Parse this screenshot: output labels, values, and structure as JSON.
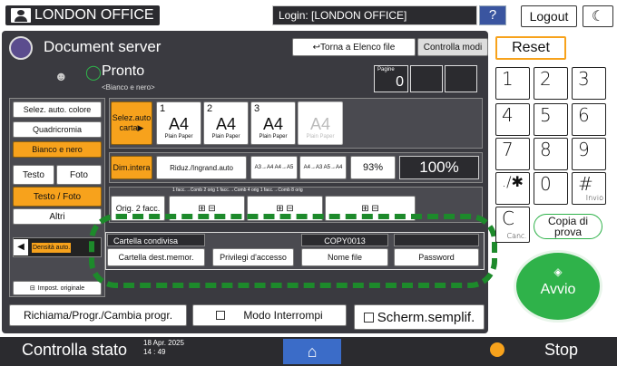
{
  "top": {
    "office": "LONDON OFFICE",
    "login": "Login: [LONDON OFFICE]",
    "help": "?",
    "logout": "Logout"
  },
  "header": {
    "title": "Document server",
    "toma": "Torna a Elenco file",
    "controlla": "Controlla modi",
    "status": "Pronto",
    "substatus": "<Bianco e nero>",
    "pagine_label": "Pagine",
    "pagine_value": "0"
  },
  "left": {
    "selez_colore": "Selez. auto. colore",
    "quadricromia": "Quadricromia",
    "bianco_nero": "Bianco e nero",
    "testo": "Testo",
    "foto": "Foto",
    "testo_foto": "Testo / Foto",
    "altri": "Altri",
    "densita": "Densità auto.",
    "impost": "Impost. originale"
  },
  "paper": {
    "selez_auto": "Selez.auto carta▶",
    "trays": [
      {
        "num": "1",
        "size": "A4",
        "type": "Plain Paper"
      },
      {
        "num": "2",
        "size": "A4",
        "type": "Plain Paper"
      },
      {
        "num": "3",
        "size": "A4",
        "type": "Plain Paper"
      },
      {
        "num": "",
        "size": "A4",
        "type": "Plain Paper"
      }
    ]
  },
  "reduce": {
    "dim_intera": "Dim.intera",
    "riduz": "Riduz./Ingrand.auto",
    "a3a4": "A3→A4 A4→A5",
    "a4a3": "A4→A3 A5→A4",
    "pct": "93%",
    "zoom": "100%"
  },
  "combine": {
    "header": "1 facc.→Comb 2 orig 1 facc.→Comb 4 orig 1 facc.→Comb 8 orig",
    "orig": "Orig. 2 facc."
  },
  "overlay": {
    "cartella_condivisa": "Cartella condivisa",
    "copy_id": "COPY0013",
    "cartella_dest": "Cartella dest.memor.",
    "privilegi": "Privilegi d'accesso",
    "nome_file": "Nome file",
    "password": "Password"
  },
  "bottom": {
    "richiama": "Richiama/Progr./Cambia progr.",
    "modo_interrompi": "Modo Interrompi",
    "scherm": "Scherm.semplif."
  },
  "keypad": {
    "reset": "Reset",
    "keys": [
      "1",
      "2",
      "3",
      "4",
      "5",
      "6",
      "7",
      "8",
      "9",
      ".∕✱",
      "0",
      "#"
    ],
    "invio": "Invio",
    "c": "C",
    "canc": "Canc.",
    "copia_di_prova": "Copia di prova",
    "avvio": "Avvio"
  },
  "statusbar": {
    "controlla_stato": "Controlla stato",
    "date": "18 Apr. 2025",
    "time": "14 : 49",
    "stop": "Stop"
  },
  "colors": {
    "accent_orange": "#f7a21c",
    "start_green": "#2fb24a",
    "dashed_green": "#1d8a2b",
    "dark": "#2b2b2f"
  }
}
